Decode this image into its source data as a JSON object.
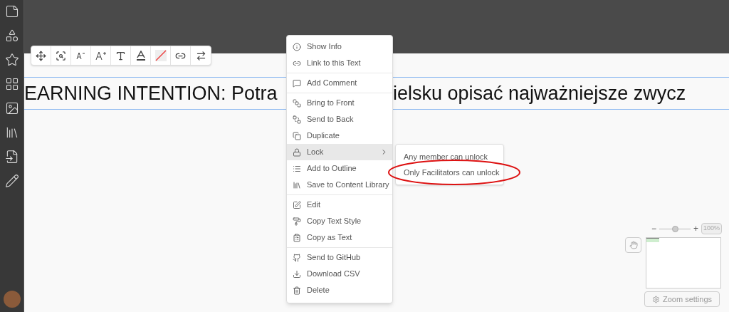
{
  "heading": {
    "visible_left": "EARNING INTENTION: Potra",
    "visible_right": "ielsku opisać najważniejsze zwycz"
  },
  "context_menu": {
    "groups": [
      [
        {
          "label": "Show Info",
          "selected": false,
          "submenu": false
        },
        {
          "label": "Link to this Text",
          "selected": false,
          "submenu": false
        }
      ],
      [
        {
          "label": "Add Comment",
          "selected": false,
          "submenu": false
        }
      ],
      [
        {
          "label": "Bring to Front",
          "selected": false,
          "submenu": false
        },
        {
          "label": "Send to Back",
          "selected": false,
          "submenu": false
        },
        {
          "label": "Duplicate",
          "selected": false,
          "submenu": false
        },
        {
          "label": "Lock",
          "selected": true,
          "submenu": true
        },
        {
          "label": "Add to Outline",
          "selected": false,
          "submenu": false
        },
        {
          "label": "Save to Content Library",
          "selected": false,
          "submenu": false
        }
      ],
      [
        {
          "label": "Edit",
          "selected": false,
          "submenu": false
        },
        {
          "label": "Copy Text Style",
          "selected": false,
          "submenu": false
        },
        {
          "label": "Copy as Text",
          "selected": false,
          "submenu": false
        }
      ],
      [
        {
          "label": "Send to GitHub",
          "selected": false,
          "submenu": false
        },
        {
          "label": "Download CSV",
          "selected": false,
          "submenu": false
        },
        {
          "label": "Delete",
          "selected": false,
          "submenu": false
        }
      ]
    ]
  },
  "submenu": {
    "items": [
      {
        "label": "Any member can unlock",
        "circled": false
      },
      {
        "label": "Only Facilitators can unlock",
        "circled": true
      }
    ]
  },
  "zoom": {
    "minus": "−",
    "plus": "+",
    "level": 0.5,
    "percent": "100%",
    "settings": "Zoom settings"
  }
}
